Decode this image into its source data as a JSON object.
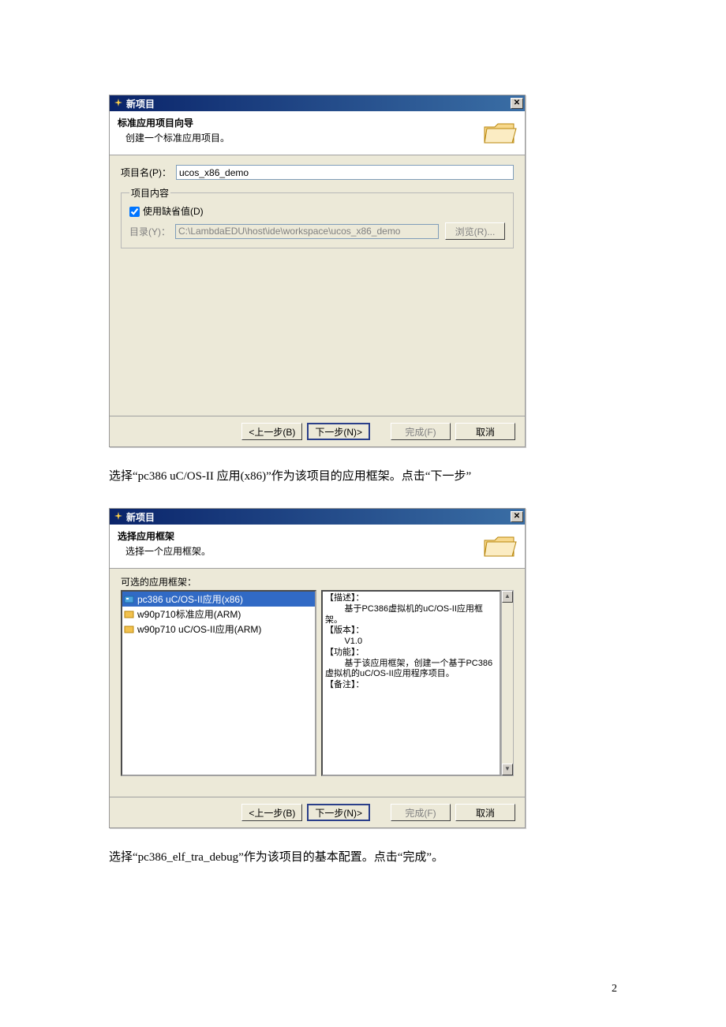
{
  "dialog1": {
    "title": "新项目",
    "banner_title": "标准应用项目向导",
    "banner_sub": "创建一个标准应用项目。",
    "proj_name_label": "项目名(P)：",
    "proj_name_value": "ucos_x86_demo",
    "group_legend": "项目内容",
    "use_default_label": "使用缺省值(D)",
    "dir_label": "目录(Y)：",
    "dir_value": "C:\\LambdaEDU\\host\\ide\\workspace\\ucos_x86_demo",
    "browse_label": "浏览(R)..."
  },
  "buttons": {
    "back": "<上一步(B)",
    "next": "下一步(N)>",
    "finish": "完成(F)",
    "cancel": "取消"
  },
  "instruction1": "选择“pc386 uC/OS-II 应用(x86)”作为该项目的应用框架。点击“下一步”",
  "dialog2": {
    "title": "新项目",
    "banner_title": "选择应用框架",
    "banner_sub": "选择一个应用框架。",
    "list_label": "可选的应用框架：",
    "items": [
      {
        "label": "pc386 uC/OS-II应用(x86)",
        "selected": true
      },
      {
        "label": "w90p710标准应用(ARM)",
        "selected": false
      },
      {
        "label": "w90p710 uC/OS-II应用(ARM)",
        "selected": false
      }
    ],
    "desc_h1": "【描述】：",
    "desc_l1": "        基于PC386虚拟机的uC/OS-II应用框架。",
    "desc_h2": "【版本】：",
    "desc_l2": "        V1.0",
    "desc_h3": "【功能】：",
    "desc_l3": "        基于该应用框架，创建一个基于PC386虚拟机的uC/OS-II应用程序项目。",
    "desc_h4": "【备注】："
  },
  "instruction2": "选择“pc386_elf_tra_debug”作为该项目的基本配置。点击“完成”。",
  "page_number": "2"
}
